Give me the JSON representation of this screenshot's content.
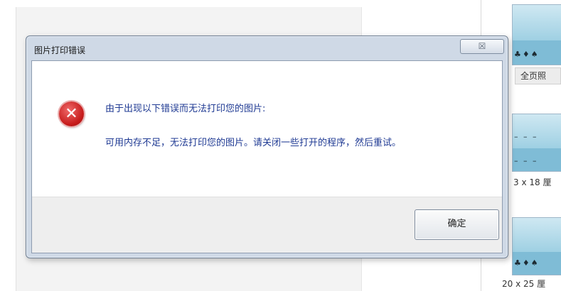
{
  "dialog": {
    "title": "图片打印错误",
    "close_label": "ⅩⅩ",
    "main_message": "由于出现以下错误而无法打印您的图片:",
    "detail_message": "可用内存不足，无法打印您的图片。请关闭一些打开的程序，然后重试。",
    "ok_label": "确定",
    "icon": "error-icon"
  },
  "thumbnails": [
    {
      "label": "全页照"
    },
    {
      "label": "3 x 18 厘"
    },
    {
      "label": "20 x 25 厘"
    }
  ]
}
